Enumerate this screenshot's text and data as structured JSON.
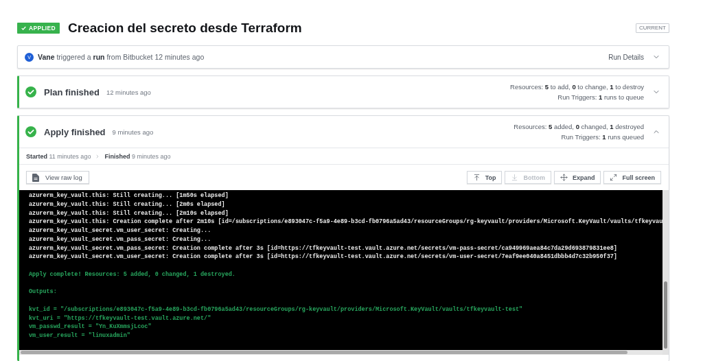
{
  "header": {
    "badge": "APPLIED",
    "title": "Creacion del secreto desde Terraform",
    "tag": "CURRENT"
  },
  "trigger": {
    "avatar": "V",
    "text": "**Vane** triggered a **run** from Bitbucket 12 minutes ago",
    "link": "Run Details",
    "expanded": false
  },
  "phases": [
    {
      "title": "Plan finished",
      "time": "12 minutes ago",
      "succeeded": true,
      "expanded": false,
      "summary": [
        "Resources: **5** to add, **0** to change, **1** to destroy",
        "Run Triggers: **1** runs to queue"
      ]
    },
    {
      "title": "Apply finished",
      "time": "9 minutes ago",
      "succeeded": true,
      "expanded": true,
      "summary": [
        "Resources: **5** added, **0** changed, **1** destroyed",
        "Run Triggers: **1** runs queued"
      ],
      "timeline": [
        "**Started** 11 minutes ago",
        "**Finished** 9 minutes ago"
      ],
      "raw_log_button": "View raw log",
      "log_buttons": [
        {
          "kind": "top",
          "label": "Top",
          "disabled": false
        },
        {
          "kind": "bottom",
          "label": "Bottom",
          "disabled": true
        },
        {
          "kind": "expand",
          "label": "Expand",
          "disabled": false
        },
        {
          "kind": "fullscreen",
          "label": "Full screen",
          "disabled": false
        }
      ],
      "log": [
        {
          "kind": "plain",
          "lines": [
            "azurerm_key_vault.this: Still creating... [1m50s elapsed]",
            "azurerm_key_vault.this: Still creating... [2m0s elapsed]",
            "azurerm_key_vault.this: Still creating... [2m10s elapsed]",
            "azurerm_key_vault.this: Creation complete after 2m10s [id=/subscriptions/e893047c-f5a9-4e89-b3cd-fb0796a5ad43/resourceGroups/rg-keyvault/providers/Microsoft.KeyVault/vaults/tfkeyvau",
            "azurerm_key_vault_secret.vm_user_secret: Creating...",
            "azurerm_key_vault_secret.vm_pass_secret: Creating...",
            "azurerm_key_vault_secret.vm_pass_secret: Creation complete after 3s [id=https://tfkeyvault-test.vault.azure.net/secrets/vm-pass-secret/ca949969aea84c7da29d693879831ee8]",
            "azurerm_key_vault_secret.vm_user_secret: Creation complete after 3s [id=https://tfkeyvault-test.vault.azure.net/secrets/vm-user-secret/7eaf9ee040a8451dbbb4d7c32b950f37]"
          ]
        },
        {
          "kind": "success",
          "lines": [
            "Apply complete! Resources: 5 added, 0 changed, 1 destroyed."
          ]
        },
        {
          "kind": "success",
          "lines": [
            "Outputs:"
          ]
        },
        {
          "kind": "success",
          "lines": [
            "kvt_id = \"/subscriptions/e893047c-f5a9-4e89-b3cd-fb0796a5ad43/resourceGroups/rg-keyvault/providers/Microsoft.KeyVault/vaults/tfkeyvault-test\"",
            "kvt_uri = \"https://tfkeyvault-test.vault.azure.net/\"",
            "vm_passwd_result = \"Yn_KuXmmsjLcoc\"",
            "vm_user_result = \"linuxadmin\""
          ]
        }
      ]
    }
  ]
}
